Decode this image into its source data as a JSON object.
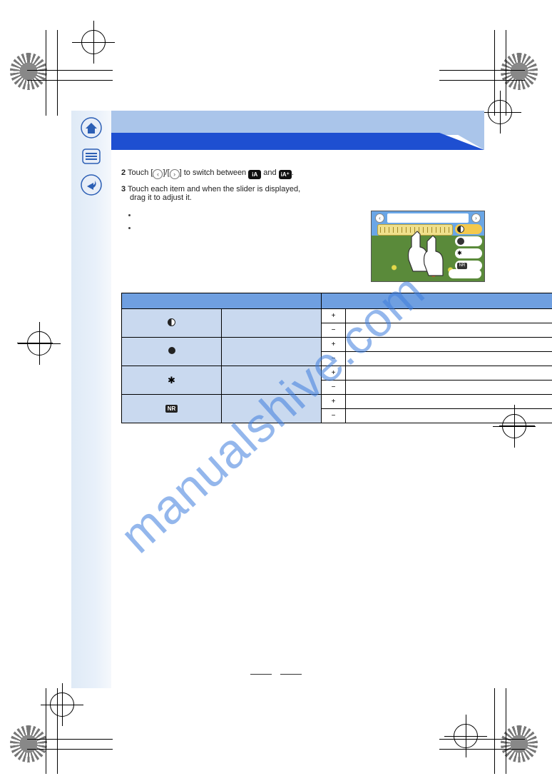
{
  "watermark": "manualshive.com",
  "page_number": "",
  "nav": {
    "home": "home-icon",
    "menu": "menu-icon",
    "back": "back-icon"
  },
  "intro": {
    "line1_pre": "Touch [",
    "line1_mid": "]/[",
    "line1_post": "] to switch between",
    "line1_trail_a": " and ",
    "line1_trail_b": ".",
    "line2_a": "Touch each item and when the slider is displayed,",
    "line2_b": "drag it to adjust it.",
    "bullets": [
      "",
      ""
    ]
  },
  "preview": {
    "options": [
      {
        "name": "contrast-pill"
      },
      {
        "name": "saturation-pill"
      },
      {
        "name": "sharpness-pill"
      },
      {
        "name": "nr-pill"
      }
    ]
  },
  "table": {
    "header_item": "",
    "header_effect": "",
    "rows": [
      {
        "icon": "contrast",
        "label": "",
        "plus": "+",
        "plus_effect": "",
        "minus": "−",
        "minus_effect": ""
      },
      {
        "icon": "saturation",
        "label": "",
        "plus": "+",
        "plus_effect": "",
        "minus": "−",
        "minus_effect": ""
      },
      {
        "icon": "sharpness",
        "label": "",
        "plus": "+",
        "plus_effect": "",
        "minus": "−",
        "minus_effect": ""
      },
      {
        "icon": "nr",
        "label": "",
        "plus": "+",
        "plus_effect": "",
        "minus": "−",
        "minus_effect": ""
      }
    ]
  }
}
